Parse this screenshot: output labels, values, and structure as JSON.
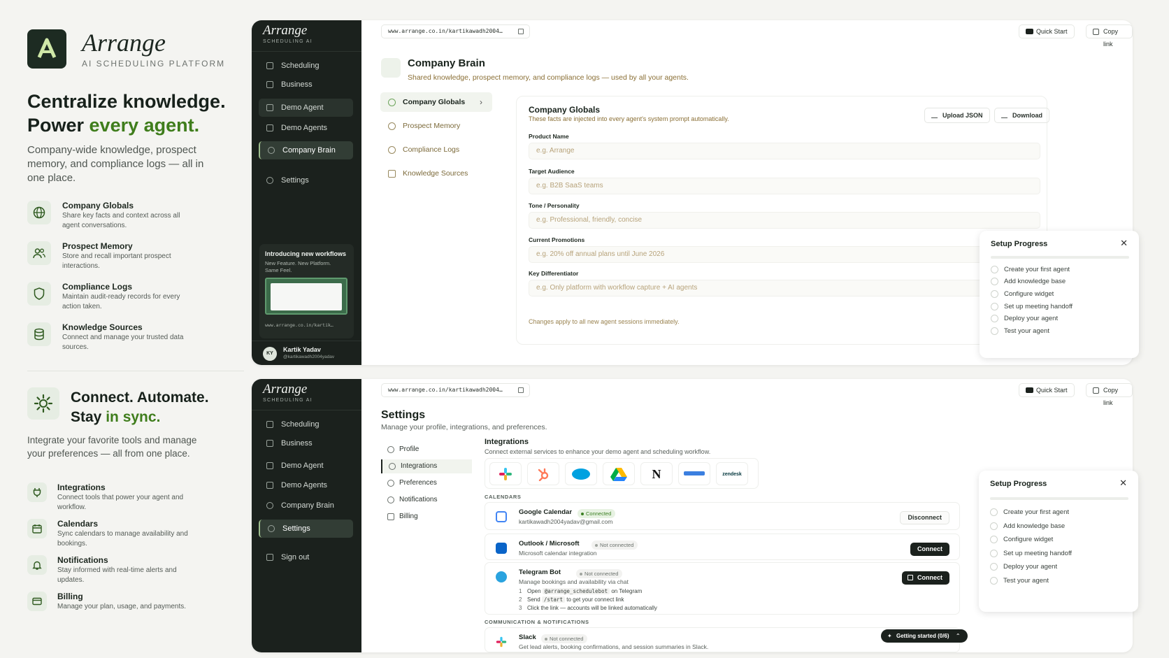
{
  "brand": {
    "name": "Arrange",
    "tagline": "AI SCHEDULING PLATFORM",
    "logo_letter": "A"
  },
  "colors": {
    "accent_green": "#3f7d1c",
    "sidebar_dark": "#1b211d",
    "muted_gold": "#8a6f35",
    "connected_green": "#3b7f23"
  },
  "section1": {
    "headline_line1": "Centralize knowledge.",
    "headline_line2_pre": "Power ",
    "headline_line2_accent": "every agent.",
    "description": "Company-wide knowledge, prospect memory, and compliance logs — all in one place.",
    "features": [
      {
        "icon": "globe-icon",
        "title": "Company Globals",
        "desc": "Share key facts and context across all agent conversations."
      },
      {
        "icon": "users-icon",
        "title": "Prospect Memory",
        "desc": "Store and recall important prospect interactions."
      },
      {
        "icon": "shield-icon",
        "title": "Compliance Logs",
        "desc": "Maintain audit-ready records for every action taken."
      },
      {
        "icon": "database-icon",
        "title": "Knowledge Sources",
        "desc": "Connect and manage your trusted data sources."
      }
    ]
  },
  "section2": {
    "headline_line1": "Connect. Automate.",
    "headline_line2_pre": "Stay ",
    "headline_line2_accent": "in sync.",
    "description": "Integrate your favorite tools and manage your preferences — all from one place.",
    "features": [
      {
        "icon": "plug-icon",
        "title": "Integrations",
        "desc": "Connect tools that power your agent and workflow."
      },
      {
        "icon": "calendar-icon",
        "title": "Calendars",
        "desc": "Sync calendars to manage availability and bookings."
      },
      {
        "icon": "bell-icon",
        "title": "Notifications",
        "desc": "Stay informed with real-time alerts and updates."
      },
      {
        "icon": "card-icon",
        "title": "Billing",
        "desc": "Manage your plan, usage, and payments."
      }
    ]
  },
  "app": {
    "brand": "Arrange",
    "brand_sub": "SCHEDULING AI",
    "url": "www.arrange.co.in/kartikawadh2004…",
    "quick_start": "Quick Start",
    "copy_link": "Copy link",
    "avatar_initials": "KY"
  },
  "window1": {
    "sidebar": [
      "Scheduling",
      "Business",
      "Demo Agent",
      "Demo Agents",
      "Company Brain",
      "Settings"
    ],
    "promo": {
      "title": "Introducing new workflows",
      "desc": "New Feature. New Platform. Same Feel.",
      "url": "www.arrange.co.in/kartik…"
    },
    "user": {
      "name": "Kartik Yadav",
      "handle": "@kartikawadh2004yadav"
    },
    "page_title": "Company Brain",
    "page_sub": "Shared knowledge, prospect memory, and compliance logs — used by all your agents.",
    "subnav": [
      "Company Globals",
      "Prospect Memory",
      "Compliance Logs",
      "Knowledge Sources"
    ],
    "card": {
      "title": "Company Globals",
      "sub": "These facts are injected into every agent's system prompt automatically.",
      "upload": "Upload JSON",
      "download": "Download",
      "fields": [
        {
          "label": "Product Name",
          "placeholder": "e.g. Arrange"
        },
        {
          "label": "Target Audience",
          "placeholder": "e.g. B2B SaaS teams"
        },
        {
          "label": "Tone / Personality",
          "placeholder": "e.g. Professional, friendly, concise"
        },
        {
          "label": "Current Promotions",
          "placeholder": "e.g. 20% off annual plans until June 2026"
        },
        {
          "label": "Key Differentiator",
          "placeholder": "e.g. Only platform with workflow capture + AI agents"
        }
      ],
      "note": "Changes apply to all new agent sessions immediately."
    }
  },
  "setup": {
    "title": "Setup Progress",
    "close": "✕",
    "items": [
      "Create your first agent",
      "Add knowledge base",
      "Configure widget",
      "Set up meeting handoff",
      "Deploy your agent",
      "Test your agent"
    ]
  },
  "window2": {
    "sidebar": [
      "Scheduling",
      "Business",
      "Demo Agent",
      "Demo Agents",
      "Company Brain",
      "Settings",
      "Sign out"
    ],
    "title": "Settings",
    "sub": "Manage your profile, integrations, and preferences.",
    "nav": [
      "Profile",
      "Integrations",
      "Preferences",
      "Notifications",
      "Billing"
    ],
    "int_title": "Integrations",
    "int_sub": "Connect external services to enhance your demo agent and scheduling workflow.",
    "logos": [
      "slack",
      "hubspot",
      "salesforce",
      "drive",
      "N",
      "ms",
      "zendesk"
    ],
    "calendars_label": "CALENDARS",
    "comm_label": "COMMUNICATION & NOTIFICATIONS",
    "rows": [
      {
        "name": "Google Calendar",
        "status": "Connected",
        "desc": "kartikawadh2004yadav@gmail.com",
        "action": "Disconnect"
      },
      {
        "name": "Outlook / Microsoft",
        "status": "Not connected",
        "desc": "Microsoft calendar integration",
        "action": "Connect"
      },
      {
        "name": "Telegram Bot",
        "status": "Not connected",
        "desc": "Manage bookings and availability via chat",
        "action": "Connect"
      }
    ],
    "telegram_steps": [
      {
        "n": "1",
        "pre": "Open",
        "code": "@arrange_schedulebot",
        "post": "on Telegram"
      },
      {
        "n": "2",
        "pre": "Send",
        "code": "/start",
        "post": "to get your connect link"
      },
      {
        "n": "3",
        "pre": "Click the link — accounts will be linked automatically",
        "code": "",
        "post": ""
      }
    ],
    "slack": {
      "name": "Slack",
      "status": "Not connected",
      "desc": "Get lead alerts, booking confirmations, and session summaries in Slack."
    },
    "getting_started": "Getting started (0/6)"
  }
}
